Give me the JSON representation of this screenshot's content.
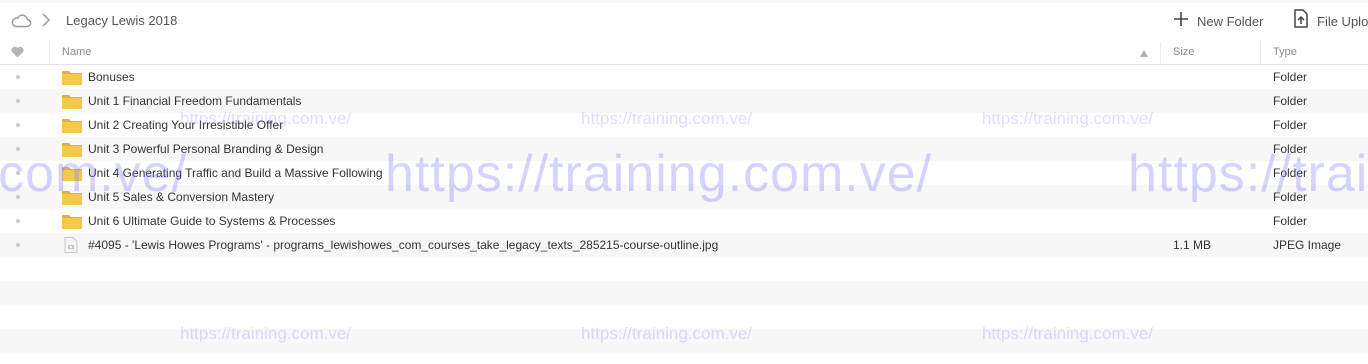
{
  "breadcrumb": {
    "root_icon": "cloud-icon",
    "separator_icon": "chevron-right-icon",
    "current": "Legacy Lewis 2018"
  },
  "toolbar": {
    "new_folder_label": "New Folder",
    "new_folder_icon": "plus-icon",
    "file_upload_label": "File Uplo",
    "file_upload_icon": "file-upload-icon"
  },
  "table": {
    "favorite_column_icon": "heart-icon",
    "columns": {
      "name": "Name",
      "size": "Size",
      "type": "Type"
    },
    "sort_icon": "sort-ascending-icon",
    "rows": [
      {
        "icon": "folder-icon",
        "name": "Bonuses",
        "size": "",
        "type": "Folder"
      },
      {
        "icon": "folder-icon",
        "name": "Unit 1 Financial Freedom Fundamentals",
        "size": "",
        "type": "Folder"
      },
      {
        "icon": "folder-icon",
        "name": "Unit 2 Creating Your Irresistible Offer",
        "size": "",
        "type": "Folder"
      },
      {
        "icon": "folder-icon",
        "name": "Unit 3 Powerful Personal Branding & Design",
        "size": "",
        "type": "Folder"
      },
      {
        "icon": "folder-icon",
        "name": "Unit 4 Generating Traffic and Build a Massive Following",
        "size": "",
        "type": "Folder"
      },
      {
        "icon": "folder-icon",
        "name": "Unit 5 Sales & Conversion Mastery",
        "size": "",
        "type": "Folder"
      },
      {
        "icon": "folder-icon",
        "name": "Unit 6 Ultimate Guide to Systems & Processes",
        "size": "",
        "type": "Folder"
      },
      {
        "icon": "image-file-icon",
        "name": "#4095 - 'Lewis Howes Programs' - programs_lewishowes_com_courses_take_legacy_texts_285215-course-outline.jpg",
        "size": "1.1 MB",
        "type": "JPEG Image"
      }
    ]
  },
  "watermark": {
    "large_text": "https://training.com.ve/",
    "small_text": "https://training.com.ve/"
  },
  "colors": {
    "folder": "#f2c94c",
    "folder_dark": "#e0b43a",
    "watermark": "#7878ff",
    "row_alt": "#f7f7f7"
  }
}
